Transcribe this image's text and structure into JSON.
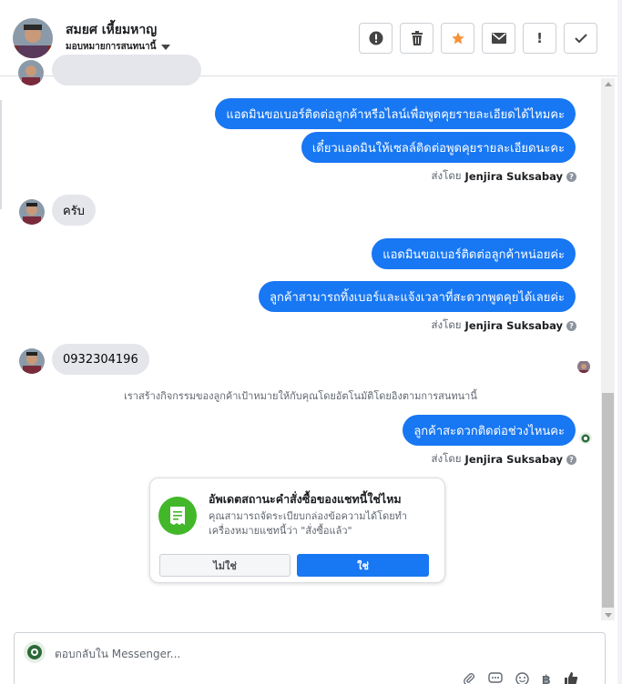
{
  "header": {
    "name": "สมยศ เหี้ยมหาญ",
    "assign_label": "มอบหมายการสนทนานี้",
    "actions": [
      {
        "icon": "alert-circle-icon",
        "glyph": "!"
      },
      {
        "icon": "trash-icon",
        "glyph": "🗑"
      },
      {
        "icon": "star-icon",
        "glyph": "★"
      },
      {
        "icon": "envelope-icon",
        "glyph": "✉"
      },
      {
        "icon": "exclamation-icon",
        "glyph": "!"
      },
      {
        "icon": "check-icon",
        "glyph": "✓"
      }
    ]
  },
  "messages": {
    "out1": "แอดมินขอเบอร์ติดต่อลูกค้าหรือไลน์เพื่อพูดคุยรายละเอียดได้ไหมคะ",
    "out2": "เดี๋ยวแอดมินให้เซลล์ติดต่อพูดคุยรายละเอียดนะคะ",
    "sent_by_prefix": "ส่งโดย",
    "sent_by_name": "Jenjira Suksabay",
    "in1": "ครับ",
    "out3": "แอดมินขอเบอร์ติดต่อลูกค้าหน่อยค่ะ",
    "out4": "ลูกค้าสามารถทิ้งเบอร์และแจ้งเวลาที่สะดวกพูดคุยได้เลยค่ะ",
    "in2": "0932304196",
    "system_note": "เราสร้างกิจกรรมของลูกค้าเป้าหมายให้กับคุณโดยอัตโนมัติโดยอิงตามการสนทนานี้",
    "out5": "ลูกค้าสะดวกติดต่อช่วงไหนคะ"
  },
  "card": {
    "title": "อัพเดตสถานะคำสั่งซื้อของแชทนี้ใช่ไหม",
    "description": "คุณสามารถจัดระเบียบกล่องข้อความได้โดยทำเครื่องหมายแชทนี้ว่า \"สั่งซื้อแล้ว\"",
    "no_label": "ไม่ใช่",
    "yes_label": "ใช่"
  },
  "composer": {
    "placeholder": "ตอบกลับใน Messenger..."
  },
  "colors": {
    "accent": "#1877f2",
    "star": "#f7923a",
    "green": "#42b72a"
  }
}
